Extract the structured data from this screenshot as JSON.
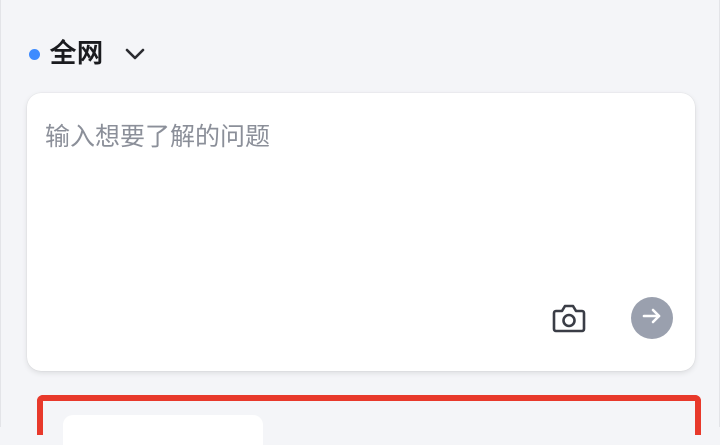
{
  "scope": {
    "label": "全网",
    "dot_color": "#3d8bff"
  },
  "query": {
    "placeholder": "输入想要了解的问题",
    "value": ""
  },
  "actions": {
    "camera_icon": "camera-icon",
    "send_icon": "arrow-right-icon",
    "send_color": "#9aa0ae"
  },
  "highlight": {
    "color": "#e8392b"
  }
}
